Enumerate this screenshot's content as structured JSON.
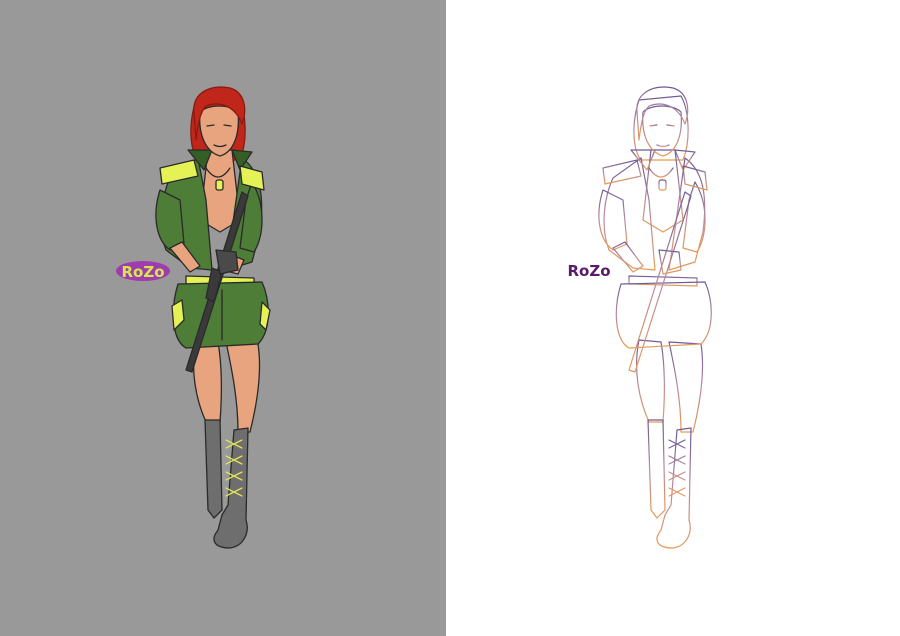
{
  "panels": [
    {
      "id": "colored",
      "background": "#999999",
      "style": "colored",
      "signature_text": "RoZo",
      "colors": {
        "hair": "#c0271a",
        "hair_dark": "#8a1a10",
        "skin": "#e7a47e",
        "skin_shadow": "#cf8863",
        "uniform": "#4d7d36",
        "uniform_dark": "#355e25",
        "accent": "#e5f255",
        "boots": "#6e6e6e",
        "boots_dark": "#4a4a4a",
        "laces": "#e0e05a",
        "gun": "#3a3a3a",
        "outline": "#2a2a2a",
        "signature_fill": "#d3e84b",
        "signature_stroke": "#a03cb0"
      }
    },
    {
      "id": "lineart",
      "background": "#ffffff",
      "style": "lineart",
      "signature_text": "RoZo",
      "colors": {
        "line_top": "#6f5a98",
        "line_mid": "#b88a9c",
        "line_bottom": "#e89a55",
        "signature_fill": "#5a1a6a"
      }
    }
  ]
}
